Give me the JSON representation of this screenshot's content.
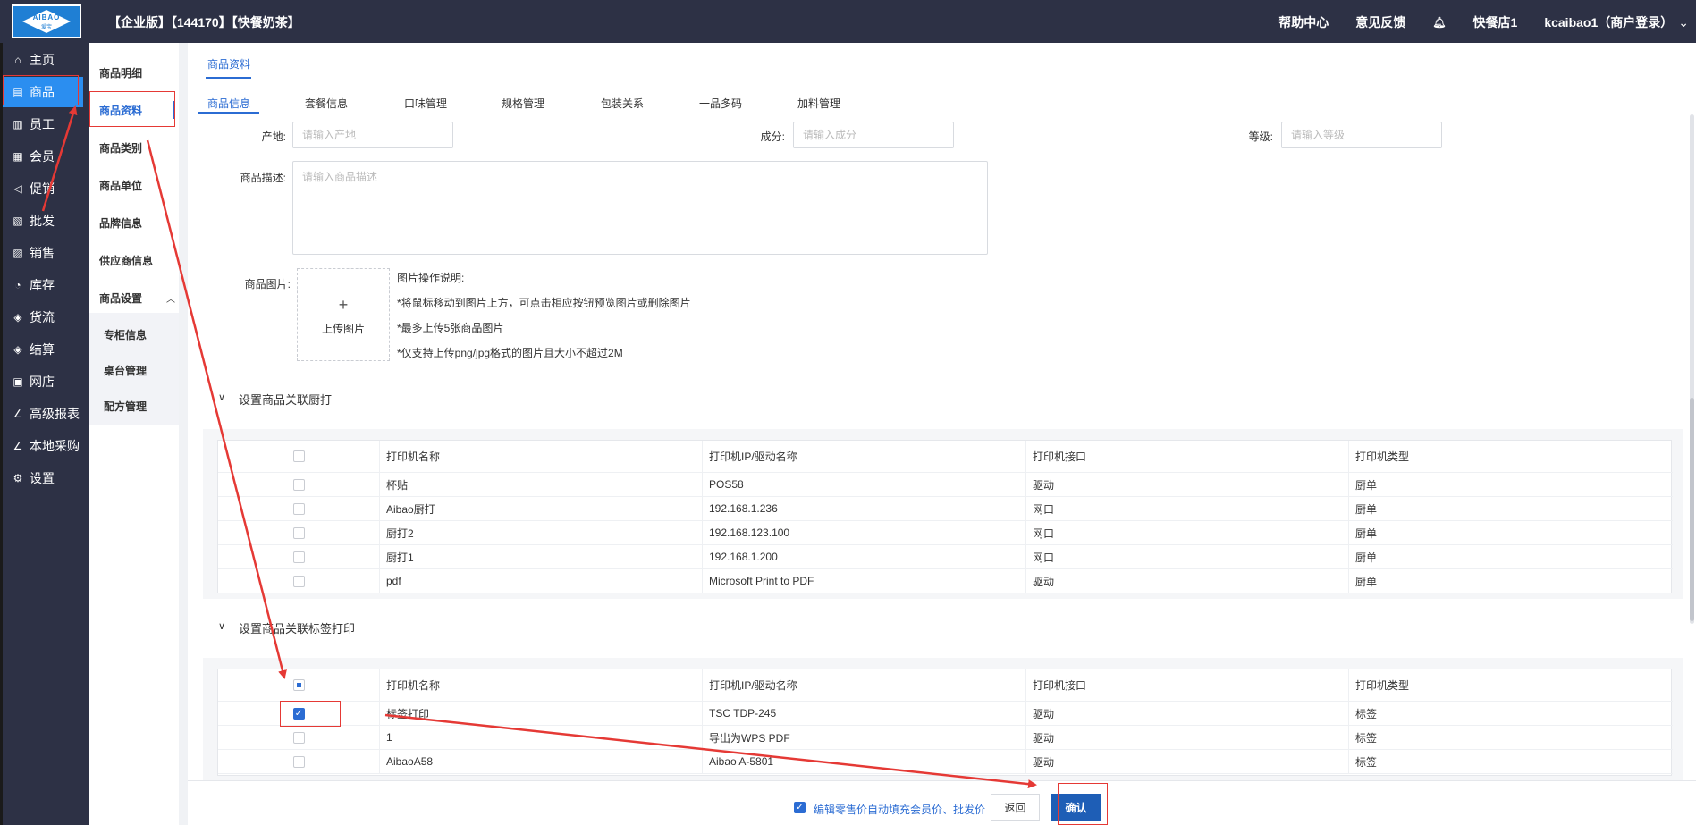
{
  "header": {
    "title": "【企业版】【144170】【快餐奶茶】",
    "logo_text": "AIBAO",
    "logo_sub": "爱宝",
    "help": "帮助中心",
    "feedback": "意见反馈",
    "store": "快餐店1",
    "user": "kcaibao1（商户登录）"
  },
  "nav": {
    "items": [
      {
        "label": "主页",
        "icon": "home-icon"
      },
      {
        "label": "商品",
        "icon": "goods-icon"
      },
      {
        "label": "员工",
        "icon": "staff-icon"
      },
      {
        "label": "会员",
        "icon": "member-icon"
      },
      {
        "label": "促销",
        "icon": "promo-icon"
      },
      {
        "label": "批发",
        "icon": "wholesale-icon"
      },
      {
        "label": "销售",
        "icon": "sales-icon"
      },
      {
        "label": "库存",
        "icon": "stock-icon"
      },
      {
        "label": "货流",
        "icon": "flow-icon"
      },
      {
        "label": "结算",
        "icon": "settle-icon"
      },
      {
        "label": "网店",
        "icon": "shop-icon"
      },
      {
        "label": "高级报表",
        "icon": "report-icon"
      },
      {
        "label": "本地采购",
        "icon": "purchase-icon"
      },
      {
        "label": "设置",
        "icon": "gear-icon"
      }
    ]
  },
  "subnav": {
    "items": [
      "商品明细",
      "商品资料",
      "商品类别",
      "商品单位",
      "品牌信息",
      "供应商信息",
      "商品设置"
    ],
    "children": [
      "专柜信息",
      "桌台管理",
      "配方管理"
    ]
  },
  "page_tab": "商品资料",
  "sub_tabs": [
    "商品信息",
    "套餐信息",
    "口味管理",
    "规格管理",
    "包装关系",
    "一品多码",
    "加料管理"
  ],
  "form": {
    "origin_label": "产地:",
    "origin_placeholder": "请输入产地",
    "ingredient_label": "成分:",
    "ingredient_placeholder": "请输入成分",
    "grade_label": "等级:",
    "grade_placeholder": "请输入等级",
    "desc_label": "商品描述:",
    "desc_placeholder": "请输入商品描述",
    "image_label": "商品图片:",
    "upload_label": "上传图片",
    "notes": [
      "图片操作说明:",
      "*将鼠标移动到图片上方，可点击相应按钮预览图片或删除图片",
      "*最多上传5张商品图片",
      "*仅支持上传png/jpg格式的图片且大小不超过2M"
    ]
  },
  "kitchen_section": {
    "title": "设置商品关联厨打",
    "headers": [
      "打印机名称",
      "打印机IP/驱动名称",
      "打印机接口",
      "打印机类型"
    ],
    "rows": [
      {
        "name": "杯贴",
        "ip": "POS58",
        "iface": "驱动",
        "type": "厨单"
      },
      {
        "name": "Aibao厨打",
        "ip": "192.168.1.236",
        "iface": "网口",
        "type": "厨单"
      },
      {
        "name": "厨打2",
        "ip": "192.168.123.100",
        "iface": "网口",
        "type": "厨单"
      },
      {
        "name": "厨打1",
        "ip": "192.168.1.200",
        "iface": "网口",
        "type": "厨单"
      },
      {
        "name": "pdf",
        "ip": "Microsoft Print to PDF",
        "iface": "驱动",
        "type": "厨单"
      }
    ]
  },
  "label_section": {
    "title": "设置商品关联标签打印",
    "headers": [
      "打印机名称",
      "打印机IP/驱动名称",
      "打印机接口",
      "打印机类型"
    ],
    "rows": [
      {
        "name": "标签打印",
        "ip": "TSC TDP-245",
        "iface": "驱动",
        "type": "标签",
        "checked": true
      },
      {
        "name": "1",
        "ip": "导出为WPS PDF",
        "iface": "驱动",
        "type": "标签",
        "checked": false
      },
      {
        "name": "AibaoA58",
        "ip": "Aibao A-5801",
        "iface": "驱动",
        "type": "标签",
        "checked": false
      }
    ]
  },
  "footer": {
    "autofill_text": "编辑零售价自动填充会员价、批发价",
    "back": "返回",
    "confirm": "确认"
  },
  "colors": {
    "topbar": "#2d3145",
    "accent": "#2b6cd3",
    "nav_active": "#2b8ef0",
    "annotation_red": "#e53935"
  }
}
